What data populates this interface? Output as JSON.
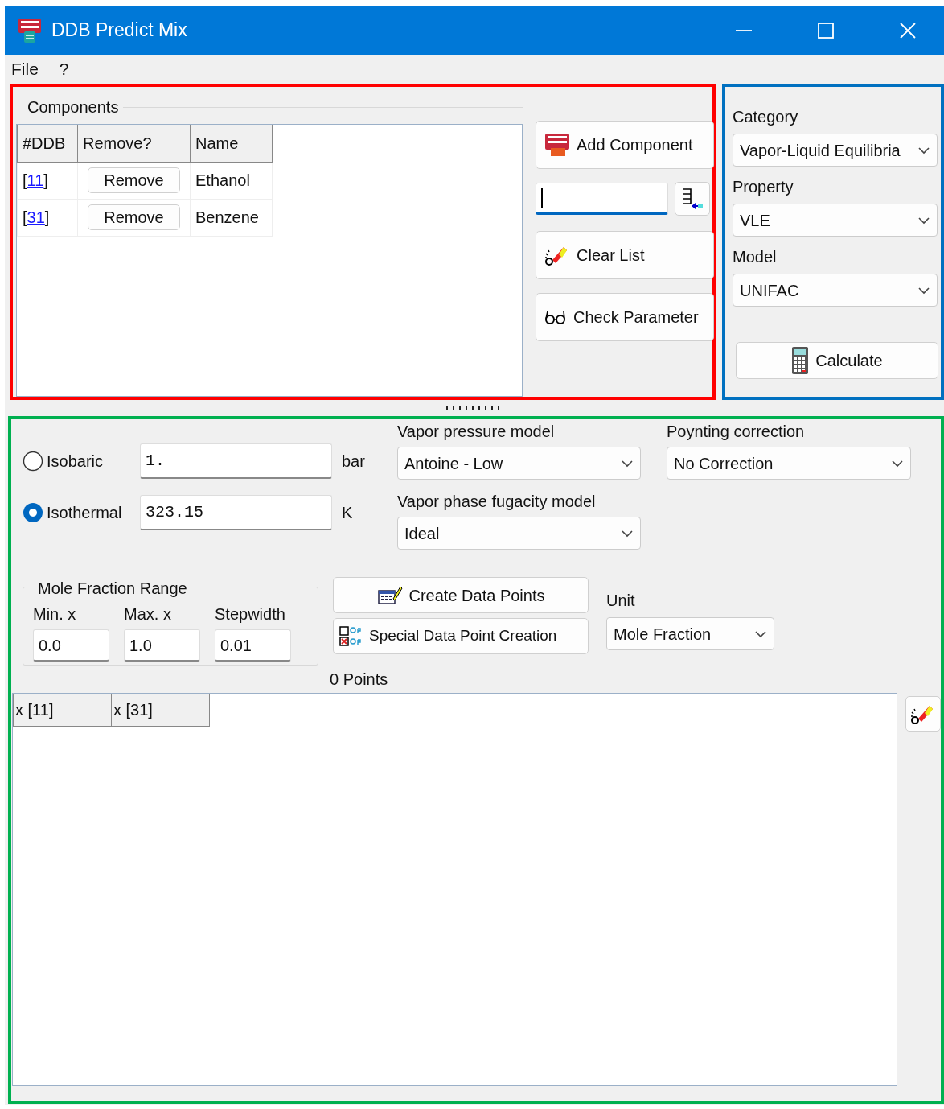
{
  "window": {
    "title": "DDB Predict Mix"
  },
  "menu": [
    "File",
    "?"
  ],
  "components_panel": {
    "color": "#ff0000",
    "group_label": "Components",
    "table": {
      "columns": [
        "#DDB",
        "Remove?",
        "Name"
      ],
      "rows": [
        {
          "number": "[11]",
          "button": "Remove",
          "name": "Ethanol"
        },
        {
          "number": "[31]",
          "button": "Remove",
          "name": "Benzene"
        }
      ]
    },
    "add_button": "Add Component",
    "search_field": {
      "focused": true
    },
    "clear_button": "Clear List",
    "check_button": "Check Parameter"
  },
  "settings_panel": {
    "color": "#0070c0",
    "fields": [
      {
        "label": "Category",
        "value": "Vapor-Liquid Equilibria"
      },
      {
        "label": "Property",
        "value": "VLE"
      },
      {
        "label": "Model",
        "value": "UNIFAC"
      }
    ],
    "calculate_button": "Calculate"
  },
  "conditions_panel": {
    "color": "#00b050",
    "modes": [
      {
        "label": "Isobaric",
        "selected": false,
        "value": "1.",
        "unit": "bar"
      },
      {
        "label": "Isothermal",
        "selected": true,
        "value": "323.15",
        "unit": "K"
      }
    ],
    "vapor_pressure_model": {
      "label": "Vapor pressure model",
      "value": "Antoine - Low"
    },
    "poynting_correction": {
      "label": "Poynting correction",
      "value": "No Correction"
    },
    "vapor_phase_fugacity_model": {
      "label": "Vapor phase fugacity model",
      "value": "Ideal"
    },
    "mole_fraction_range": {
      "label": "Mole Fraction Range",
      "fields": [
        {
          "label": "Min. x",
          "value": "0.0"
        },
        {
          "label": "Max. x",
          "value": "1.0"
        },
        {
          "label": "Stepwidth",
          "value": "0.01"
        }
      ]
    },
    "create_button": "Create Data Points",
    "special_button": "Special Data Point Creation",
    "unit": {
      "label": "Unit",
      "value": "Mole Fraction"
    },
    "points_count": "0 Points",
    "data_table": {
      "columns": [
        "x [11]",
        "x [31]"
      ]
    }
  }
}
